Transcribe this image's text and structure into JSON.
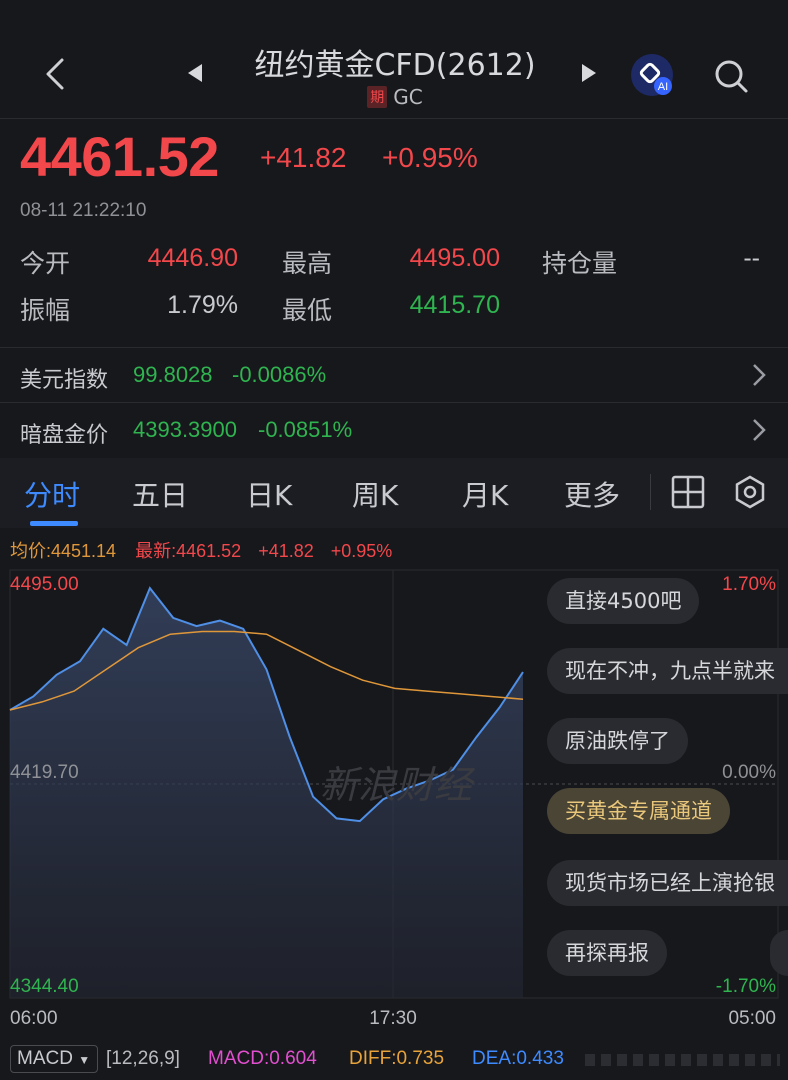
{
  "header": {
    "title": "纽约黄金CFD(2612)",
    "badge": "期",
    "code": "GC",
    "ai_label": "AI"
  },
  "quote": {
    "price": "4461.52",
    "change": "+41.82",
    "change_pct": "+0.95%",
    "timestamp": "08-11 21:22:10",
    "stats": {
      "open_label": "今开",
      "open": "4446.90",
      "high_label": "最高",
      "high": "4495.00",
      "oi_label": "持仓量",
      "oi": "--",
      "amp_label": "振幅",
      "amp": "1.79%",
      "low_label": "最低",
      "low": "4415.70"
    }
  },
  "indices": [
    {
      "label": "美元指数",
      "value": "99.8028",
      "change": "-0.0086%"
    },
    {
      "label": "暗盘金价",
      "value": "4393.3900",
      "change": "-0.0851%"
    }
  ],
  "tabs": [
    "分时",
    "五日",
    "日K",
    "周K",
    "月K",
    "更多"
  ],
  "chart_header": {
    "avg_label": "均价:4451.14",
    "latest_label": "最新:4461.52",
    "change": "+41.82",
    "change_pct": "+0.95%"
  },
  "chart_labels": {
    "y_top": "4495.00",
    "y_mid": "4419.70",
    "y_bottom": "4344.40",
    "pct_top": "1.70%",
    "pct_mid": "0.00%",
    "pct_bottom": "-1.70%",
    "x_start": "06:00",
    "x_mid": "17:30",
    "x_end": "05:00",
    "watermark": "新浪财经"
  },
  "comments": [
    "直接4500吧",
    "现在不冲，九点半就来",
    "原油跌停了",
    "买黄金专属通道",
    "现货市场已经上演抢银",
    "再探再报"
  ],
  "macd": {
    "selector": "MACD",
    "params": "[12,26,9]",
    "macd": "MACD:0.604",
    "diff": "DIFF:0.735",
    "dea": "DEA:0.433"
  },
  "colors": {
    "up": "#f2474b",
    "down": "#2fb450",
    "accent": "#3d8bff",
    "avg_line": "#e0973a",
    "price_line": "#4f8fe6"
  },
  "chart_data": {
    "type": "line",
    "title": "",
    "x": [
      "06:00",
      "17:30",
      "05:00"
    ],
    "ylim": [
      4344.4,
      4495.0
    ],
    "reference": 4419.7,
    "series": [
      {
        "name": "最新",
        "values": [
          4447,
          4452,
          4460,
          4465,
          4477,
          4471,
          4492,
          4481,
          4478,
          4480,
          4477,
          4462,
          4437,
          4415,
          4407,
          4406,
          4414,
          4418,
          4421,
          4425,
          4437,
          4448,
          4461
        ]
      },
      {
        "name": "均价",
        "values": [
          4447,
          4450,
          4454,
          4462,
          4470,
          4475,
          4476,
          4476,
          4475,
          4469,
          4463,
          4458,
          4455,
          4454,
          4453,
          4452,
          4451
        ]
      }
    ]
  }
}
